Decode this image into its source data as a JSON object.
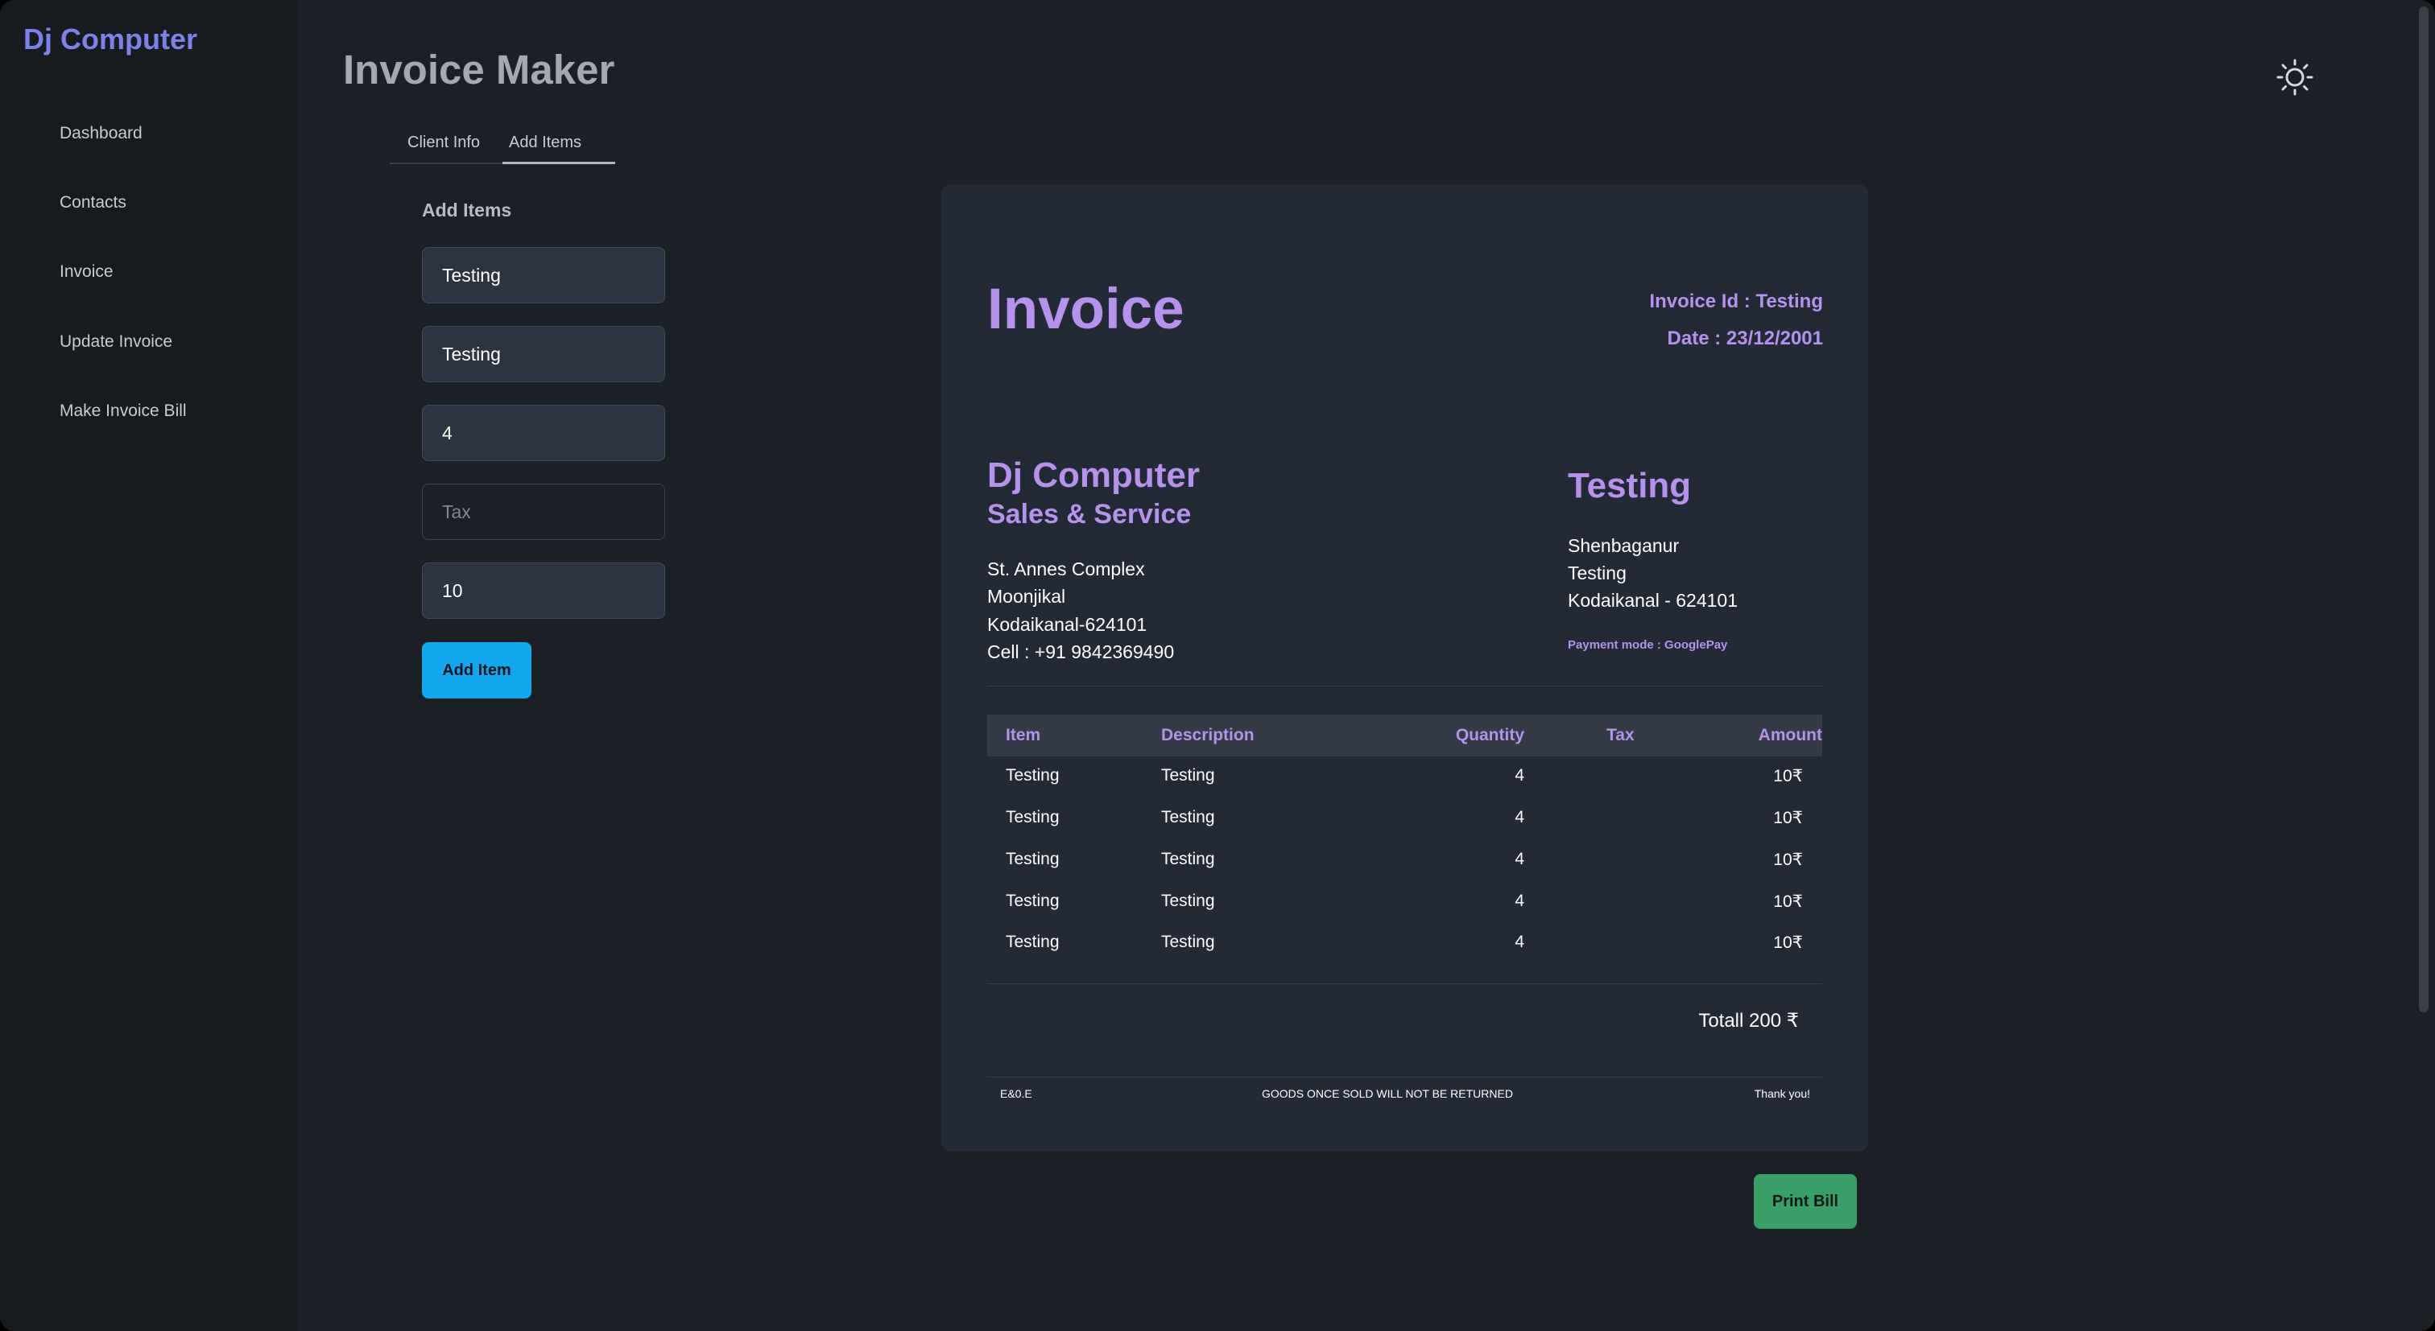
{
  "app": {
    "brand": "Dj Computer",
    "page_title": "Invoice Maker"
  },
  "sidebar": {
    "items": [
      {
        "label": "Dashboard"
      },
      {
        "label": "Contacts"
      },
      {
        "label": "Invoice"
      },
      {
        "label": "Update Invoice"
      },
      {
        "label": "Make Invoice Bill"
      }
    ]
  },
  "tabs": [
    {
      "label": "Client Info",
      "active": false
    },
    {
      "label": "Add Items",
      "active": true
    }
  ],
  "form": {
    "heading": "Add Items",
    "item_value": "Testing",
    "description_value": "Testing",
    "quantity_value": "4",
    "tax_placeholder": "Tax",
    "amount_value": "10",
    "add_button": "Add Item"
  },
  "invoice": {
    "title": "Invoice",
    "invoice_id": "Invoice Id : Testing",
    "date": "Date : 23/12/2001",
    "company_name": "Dj Computer",
    "company_tagline": "Sales & Service",
    "company_address": [
      "St. Annes Complex",
      "Moonjikal",
      "Kodaikanal-624101",
      "Cell : +91 9842369490"
    ],
    "client_name": "Testing",
    "client_address": [
      "Shenbaganur",
      "Testing",
      "Kodaikanal - 624101"
    ],
    "payment_mode": "Payment mode : GooglePay",
    "columns": [
      "Item",
      "Description",
      "Quantity",
      "Tax",
      "Amount"
    ],
    "rows": [
      {
        "item": "Testing",
        "description": "Testing",
        "quantity": "4",
        "tax": "",
        "amount": "10₹"
      },
      {
        "item": "Testing",
        "description": "Testing",
        "quantity": "4",
        "tax": "",
        "amount": "10₹"
      },
      {
        "item": "Testing",
        "description": "Testing",
        "quantity": "4",
        "tax": "",
        "amount": "10₹"
      },
      {
        "item": "Testing",
        "description": "Testing",
        "quantity": "4",
        "tax": "",
        "amount": "10₹"
      },
      {
        "item": "Testing",
        "description": "Testing",
        "quantity": "4",
        "tax": "",
        "amount": "10₹"
      }
    ],
    "total": "Totall 200 ₹",
    "footer_left": "E&0.E",
    "footer_center": "GOODS ONCE SOLD WILL NOT BE RETURNED",
    "footer_right": "Thank you!"
  },
  "print_button": "Print Bill",
  "icons": {
    "theme_toggle": "sun-icon"
  },
  "colors": {
    "accent": "#b592ec",
    "brand": "#7b83ea",
    "add_button": "#12a7ef",
    "print_button": "#3a9f67"
  }
}
